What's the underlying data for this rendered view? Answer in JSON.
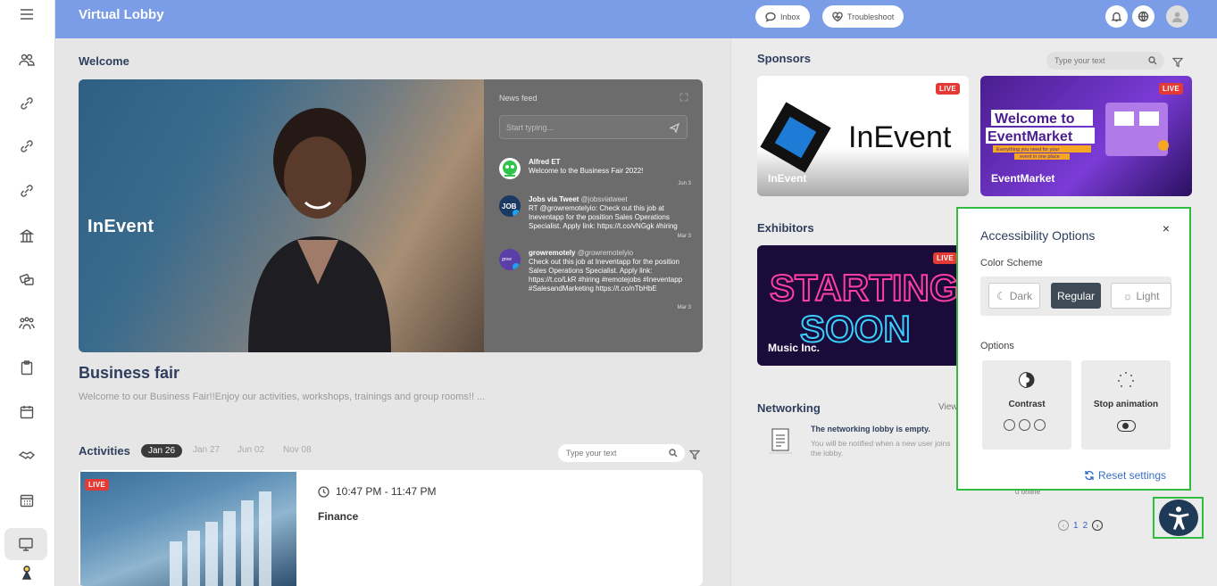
{
  "header": {
    "title": "Virtual Lobby",
    "inbox_label": "Inbox",
    "troubleshoot_label": "Troubleshoot"
  },
  "main": {
    "welcome_title": "Welcome",
    "hero_logo_text": "InEvent",
    "feed": {
      "title": "News feed",
      "placeholder": "Start typing...",
      "items": [
        {
          "name": "Alfred ET",
          "handle": "",
          "text": "Welcome to the Business Fair 2022!",
          "date": "Jun 3",
          "avatar": "alien-icon"
        },
        {
          "name": "Jobs via Tweet",
          "handle": "@jobsviatweet",
          "text": "RT @growremotelyio: Check out this job at Ineventapp for the position Sales Operations Specialist. Apply link: https://t.co/vNGgk #hiring #...",
          "date": "Mar 3",
          "avatar": "job-icon"
        },
        {
          "name": "growremotely",
          "handle": "@growremotelyio",
          "text": "Check out this job at Ineventapp for the position Sales Operations Specialist. Apply link: https://t.co/LkR #hiring #remotejobs #Ineventapp #SalesandMarketing https://t.co/nTbHbE",
          "date": "Mar 3",
          "avatar": "grow-icon"
        }
      ]
    },
    "event_title": "Business fair",
    "event_desc": "Welcome to our Business Fair!!Enjoy our activities, workshops, trainings and group rooms!! ...",
    "activities_title": "Activities",
    "date_tabs": [
      "Jan 26",
      "Jan 27",
      "Jun 02",
      "Nov 08"
    ],
    "search_placeholder": "Type your text",
    "activity": {
      "live": "LIVE",
      "time": "10:47 PM - 11:47 PM",
      "name": "Finance"
    }
  },
  "right": {
    "sponsors_title": "Sponsors",
    "search_placeholder": "Type your text",
    "sponsors": [
      {
        "name": "InEvent",
        "live": "LIVE",
        "logo_text": "InEvent"
      },
      {
        "name": "EventMarket",
        "live": "LIVE",
        "banner_line1": "Welcome to",
        "banner_line2": "EventMarket",
        "banner_tag1": "Everything you need for your",
        "banner_tag2": "event in one place"
      }
    ],
    "exhibitors_title": "Exhibitors",
    "exhibitor": {
      "name": "Music Inc.",
      "live": "LIVE",
      "line1": "STARTING",
      "line2": "SOON"
    },
    "networking_title": "Networking",
    "networking_view": "View",
    "networking_empty_title": "The networking lobby is empty.",
    "networking_empty_sub": "You will be notified when a new user joins the lobby.",
    "online_text": "0 online",
    "pages": [
      "1",
      "2"
    ]
  },
  "accessibility": {
    "title": "Accessibility Options",
    "color_scheme_label": "Color Scheme",
    "schemes": [
      "Dark",
      "Regular",
      "Light"
    ],
    "selected_scheme": "Regular",
    "options_label": "Options",
    "contrast_label": "Contrast",
    "stop_animation_label": "Stop animation",
    "reset_label": "Reset settings"
  },
  "colors": {
    "header": "#7b9de8",
    "accent_green": "#2ebd3d",
    "live_red": "#e53935",
    "link_blue": "#3a6fc9"
  }
}
